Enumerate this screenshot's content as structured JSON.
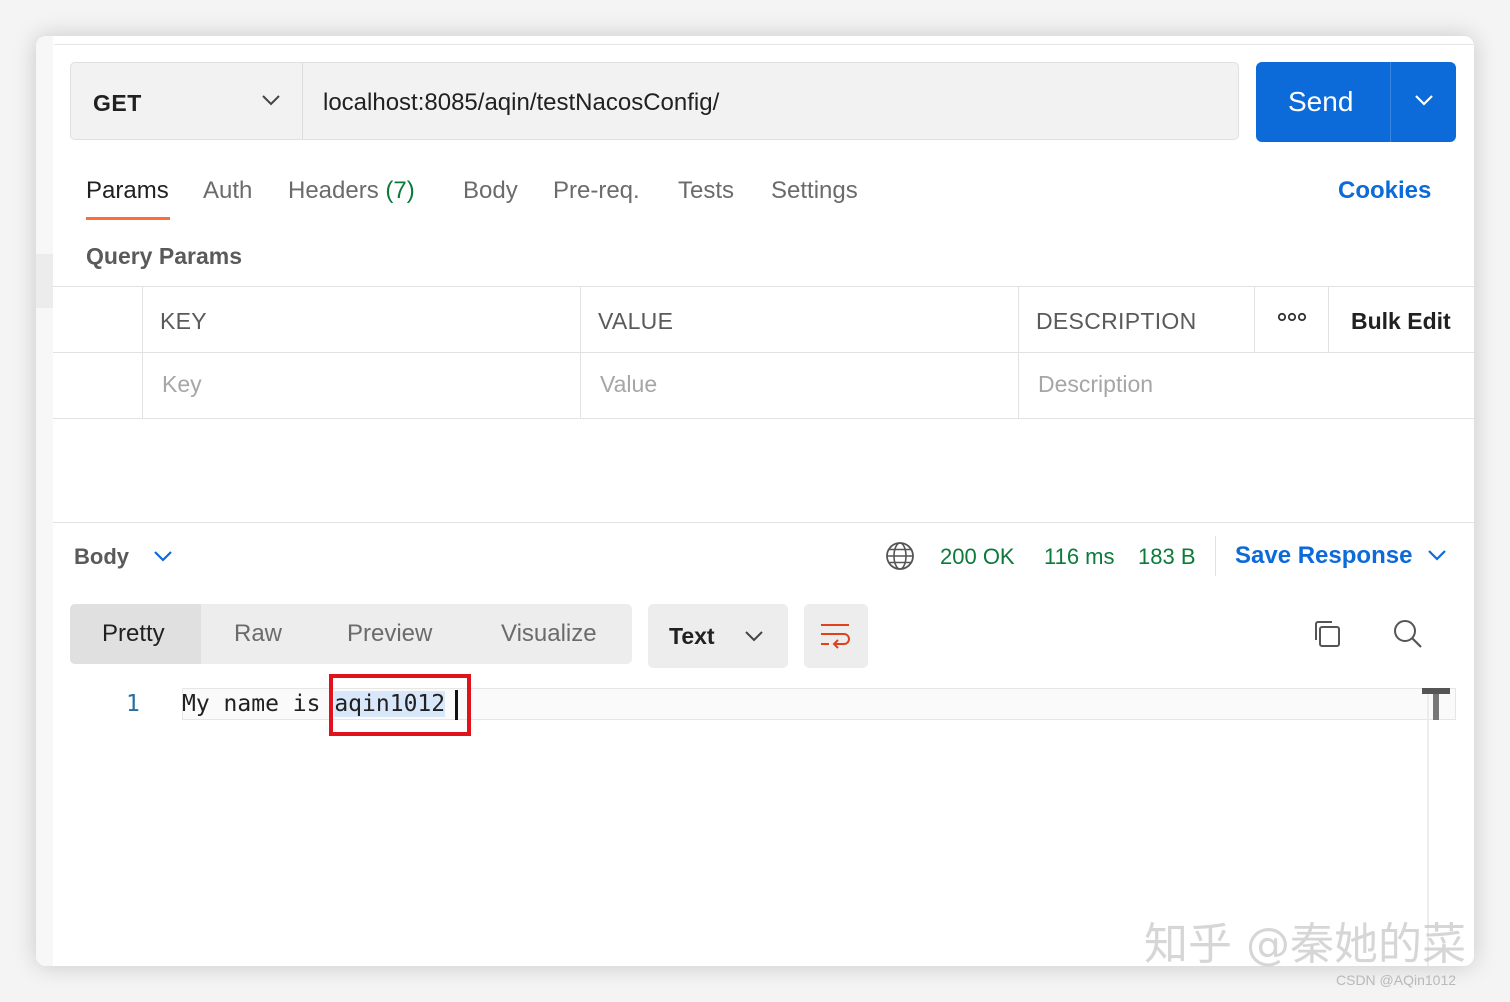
{
  "request": {
    "method": "GET",
    "url": "localhost:8085/aqin/testNacosConfig/",
    "send_label": "Send"
  },
  "tabs": [
    {
      "label": "Params",
      "active": true
    },
    {
      "label": "Auth"
    },
    {
      "label": "Headers",
      "count": "(7)"
    },
    {
      "label": "Body"
    },
    {
      "label": "Pre-req."
    },
    {
      "label": "Tests"
    },
    {
      "label": "Settings"
    }
  ],
  "cookies_label": "Cookies",
  "query_params": {
    "title": "Query Params",
    "columns": [
      "KEY",
      "VALUE",
      "DESCRIPTION"
    ],
    "bulk_edit": "Bulk Edit",
    "placeholders": [
      "Key",
      "Value",
      "Description"
    ]
  },
  "response": {
    "body_label": "Body",
    "status": "200 OK",
    "time": "116 ms",
    "size": "183 B",
    "save_label": "Save Response",
    "views": [
      "Pretty",
      "Raw",
      "Preview",
      "Visualize"
    ],
    "format": "Text",
    "line_number": "1",
    "code_prefix": "My name is ",
    "code_highlight": "aqin1012"
  },
  "watermark": {
    "zhihu": "知乎 @秦她的菜",
    "csdn": "CSDN @AQin1012"
  },
  "colors": {
    "accent": "#0c6ad9",
    "tab_underline": "#ff6c37",
    "status_ok": "#0b7a3b",
    "annotation": "#e0121b"
  }
}
